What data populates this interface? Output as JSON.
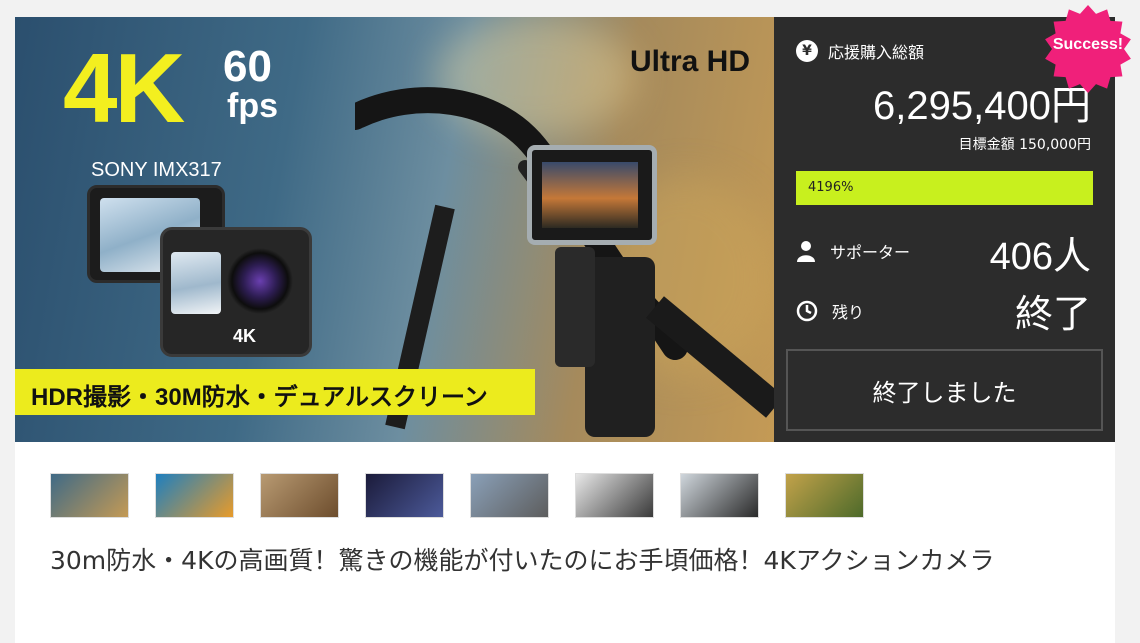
{
  "hero": {
    "big_text": "4K",
    "fps_num": "60",
    "fps_label": "fps",
    "ultra_hd": "Ultra HD",
    "sensor": "SONY IMX317",
    "camera_brand": "4K",
    "banner": "HDR撮影・30M防水・デュアルスクリーン"
  },
  "panel": {
    "total_label": "応援購入総額",
    "total_amount": "6,295,400円",
    "goal_text": "目標金額 150,000円",
    "progress_percent": 4196,
    "progress_label": "4196%",
    "supporters_label": "サポーター",
    "supporters_value": "406人",
    "remaining_label": "残り",
    "remaining_value": "終了",
    "status_button": "終了しました"
  },
  "badge": {
    "text": "Success!",
    "color": "#f0207a"
  },
  "thumbnails": [
    {
      "colors": [
        "#3f6a86",
        "#c49a55"
      ]
    },
    {
      "colors": [
        "#1e7fbf",
        "#e89b2a"
      ]
    },
    {
      "colors": [
        "#b89a72",
        "#6d4d2d"
      ]
    },
    {
      "colors": [
        "#1b1b3a",
        "#4c5a9a"
      ]
    },
    {
      "colors": [
        "#8aa0b8",
        "#5d5d5d"
      ]
    },
    {
      "colors": [
        "#e8e8e8",
        "#3a3a3a"
      ]
    },
    {
      "colors": [
        "#cfd6dc",
        "#2a2a2a"
      ]
    },
    {
      "colors": [
        "#c2a24a",
        "#4d6a2a"
      ]
    }
  ],
  "product_title": "30m防水・4Kの高画質！驚きの機能が付いたのにお手頃価格！4Kアクションカメラ",
  "colors": {
    "accent_bar": "#c8f01e",
    "panel_bg": "#2c2c2c",
    "banner_yellow": "#eceb1d"
  }
}
